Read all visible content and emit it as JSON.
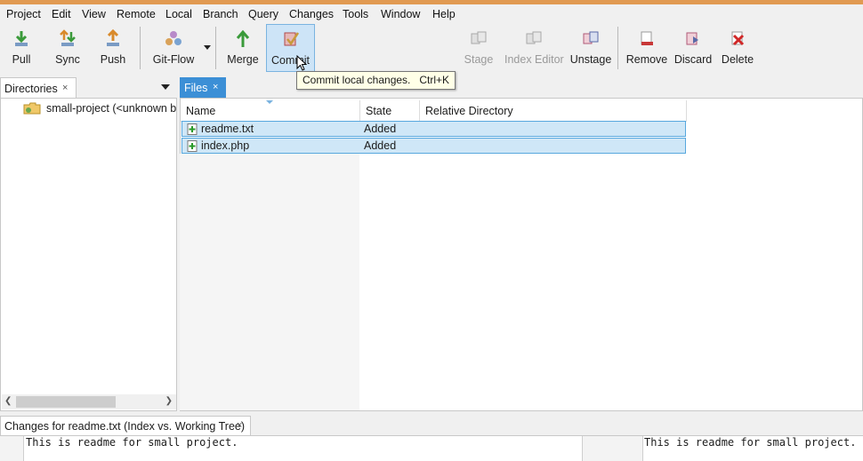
{
  "menu": [
    "Project",
    "Edit",
    "View",
    "Remote",
    "Local",
    "Branch",
    "Query",
    "Changes",
    "Tools",
    "Window",
    "Help"
  ],
  "toolbar": {
    "pull": "Pull",
    "sync": "Sync",
    "push": "Push",
    "gitflow": "Git-Flow",
    "merge": "Merge",
    "commit": "Commit",
    "stage": "Stage",
    "index_editor": "Index Editor",
    "unstage": "Unstage",
    "remove": "Remove",
    "discard": "Discard",
    "delete": "Delete"
  },
  "tooltip": {
    "text": "Commit local changes.",
    "shortcut": "Ctrl+K"
  },
  "directories": {
    "tab_label": "Directories",
    "close": "×",
    "items": [
      {
        "label": "small-project (<unknown b"
      }
    ]
  },
  "files": {
    "tab_label": "Files",
    "close": "×",
    "columns": {
      "name": "Name",
      "state": "State",
      "relative_directory": "Relative Directory"
    },
    "rows": [
      {
        "name": "readme.txt",
        "state": "Added"
      },
      {
        "name": "index.php",
        "state": "Added"
      }
    ]
  },
  "changes": {
    "tab_label": "Changes for readme.txt (Index vs. Working Tree)",
    "close": "×",
    "left_text": "This is readme for small project.",
    "right_text": "This is readme for small project."
  },
  "colors": {
    "accent": "#3c8fd6",
    "selection": "#cfe7f7",
    "selection_border": "#58a8de"
  }
}
